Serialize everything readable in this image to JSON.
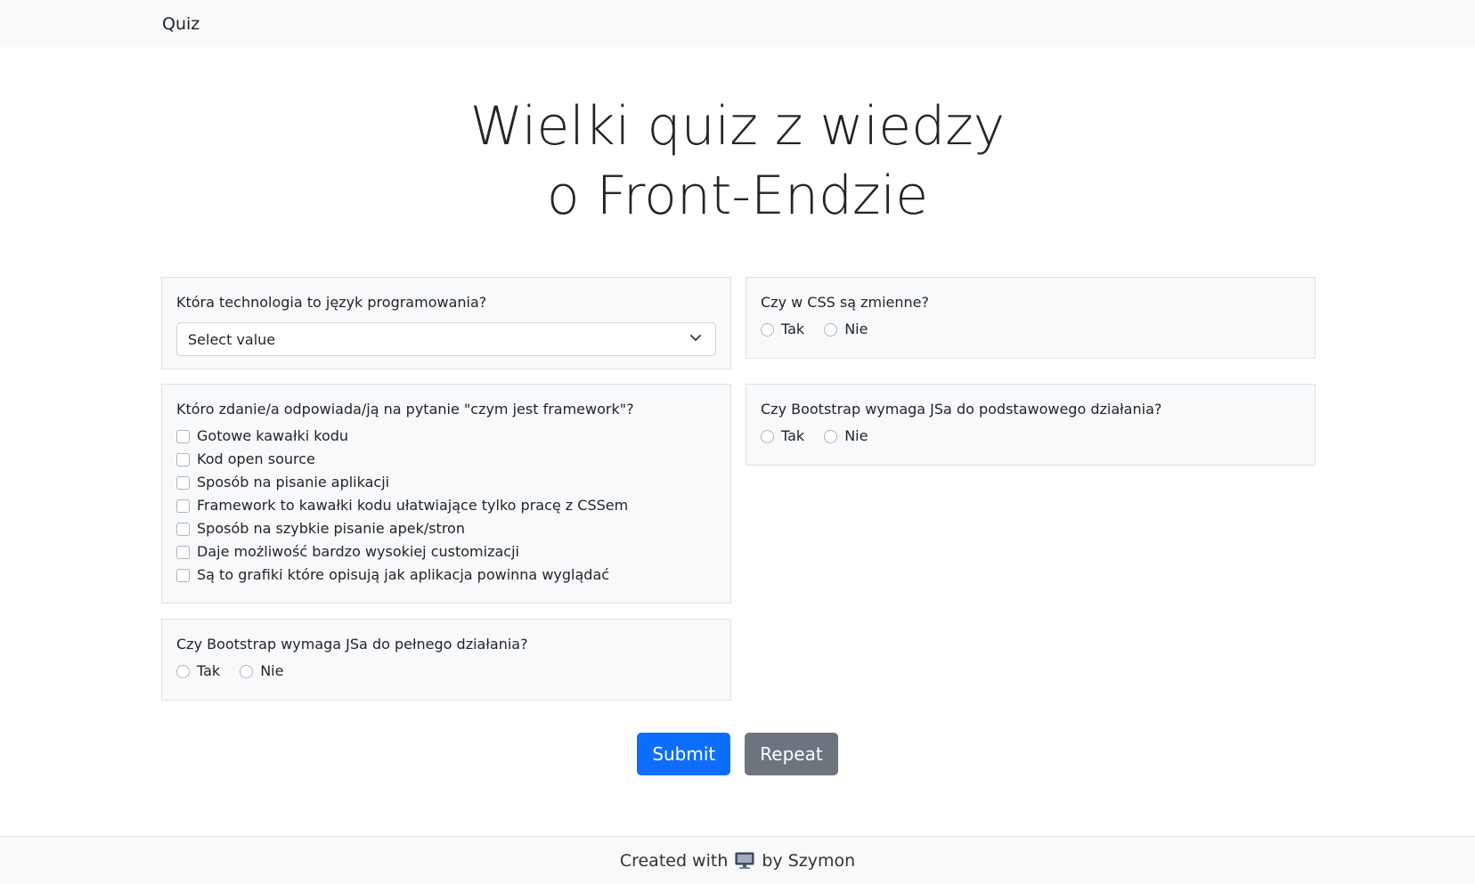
{
  "navbar": {
    "brand": "Quiz"
  },
  "hero": {
    "title_line1": "Wielki quiz z wiedzy",
    "title_line2": "o Front-Endzie"
  },
  "questions": {
    "q1": {
      "text": "Która technologia to język programowania?",
      "select_value": "Select value"
    },
    "q2": {
      "text": "Czy w CSS są zmienne?",
      "options": [
        "Tak",
        "Nie"
      ]
    },
    "q3": {
      "text": "Któro zdanie/a odpowiada/ją na pytanie \"czym jest framework\"?",
      "options": [
        "Gotowe kawałki kodu",
        "Kod open source",
        "Sposób na pisanie aplikacji",
        "Framework to kawałki kodu ułatwiające tylko pracę z CSSem",
        "Sposób na szybkie pisanie apek/stron",
        "Daje możliwość bardzo wysokiej customizacji",
        "Są to grafiki które opisują jak aplikacja powinna wyglądać"
      ]
    },
    "q4": {
      "text": "Czy Bootstrap wymaga JSa do podstawowego działania?",
      "options": [
        "Tak",
        "Nie"
      ]
    },
    "q5": {
      "text": "Czy Bootstrap wymaga JSa do pełnego działania?",
      "options": [
        "Tak",
        "Nie"
      ]
    }
  },
  "buttons": {
    "submit": "Submit",
    "repeat": "Repeat"
  },
  "footer": {
    "prefix": "Created with",
    "icon": "computer-icon",
    "suffix": "by Szymon"
  },
  "colors": {
    "primary": "#0d6efd",
    "secondary": "#6c757d",
    "card_bg": "#f8f9fa",
    "border": "#dee2e6"
  }
}
